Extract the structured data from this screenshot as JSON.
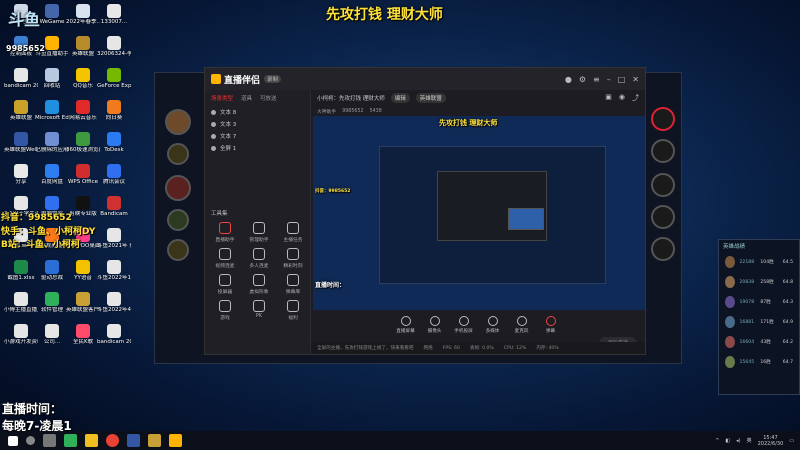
{
  "overlay": {
    "douyu_logo": "斗鱼",
    "room_id": "9985652",
    "title": "先攻打钱 理财大师",
    "douyin": "抖音：9985652",
    "kuaishou": "快手：斗鱼、小柯柯DY",
    "bilibili": "B站：斗鱼、小柯柯",
    "live_time_label": "直播时间：",
    "live_time_value": "每晚7-凌晨1"
  },
  "desktop_icons": [
    {
      "label": "我的电脑",
      "color": "#cfd8e6"
    },
    {
      "label": "WeGame",
      "color": "#4466aa"
    },
    {
      "label": "2022年春季...",
      "color": "#d9e2ef"
    },
    {
      "label": "133007...",
      "color": "#e8e8e8"
    },
    {
      "label": "控制面板",
      "color": "#3b7fd1"
    },
    {
      "label": "斗鱼直播助手",
      "color": "#ffb400"
    },
    {
      "label": "英雄联盟",
      "color": "#b88b2a"
    },
    {
      "label": "32006324-李鸿...",
      "color": "#e6e6e6"
    },
    {
      "label": "bandicam 2022-06-2...",
      "color": "#e6e6e6"
    },
    {
      "label": "回收站",
      "color": "#b6c9de"
    },
    {
      "label": "QQ音乐",
      "color": "#f5c400"
    },
    {
      "label": "GeForce Experience",
      "color": "#76b900"
    },
    {
      "label": "英雄联盟",
      "color": "#c9a227"
    },
    {
      "label": "Microsoft Edge",
      "color": "#1f8fe0"
    },
    {
      "label": "网易云音乐",
      "color": "#e02a2a"
    },
    {
      "label": "向日葵",
      "color": "#f07b1f"
    },
    {
      "label": "英雄联盟WeGame版",
      "color": "#3357a5"
    },
    {
      "label": "已删除的应用",
      "color": "#6f8fd0"
    },
    {
      "label": "360极速浏览器",
      "color": "#3d9a3d"
    },
    {
      "label": "ToDesk",
      "color": "#2a7af0"
    },
    {
      "label": "分享",
      "color": "#e9e9e9"
    },
    {
      "label": "百度网盘",
      "color": "#2c7df0"
    },
    {
      "label": "WPS Office",
      "color": "#d02e2e"
    },
    {
      "label": "腾讯会议",
      "color": "#2f6ff0"
    },
    {
      "label": "3.1用于学生课程设计...",
      "color": "#e6e6e6"
    },
    {
      "label": "电脑管家",
      "color": "#2f6ff0"
    },
    {
      "label": "剪映专业版",
      "color": "#111111"
    },
    {
      "label": "Bandicam",
      "color": "#d03030"
    },
    {
      "label": "米粒.wav",
      "color": "#eaeaea"
    },
    {
      "label": "腾讯视频播放器",
      "color": "#ff7a1a"
    },
    {
      "label": "UPUPOO桌面",
      "color": "#ff3e8a"
    },
    {
      "label": "斗鱼2021年下半年...",
      "color": "#e6e6e6"
    },
    {
      "label": "截图1.xlsx",
      "color": "#1d8a4a"
    },
    {
      "label": "驱动总裁",
      "color": "#2a6fd6"
    },
    {
      "label": "YY语音",
      "color": "#f2c200"
    },
    {
      "label": "斗鱼2022年1-3月直播...",
      "color": "#e6e6e6"
    },
    {
      "label": "小傅主播直播正式版",
      "color": "#e6e6e6"
    },
    {
      "label": "软件管理",
      "color": "#2fb15a"
    },
    {
      "label": "英雄联盟客户端",
      "color": "#c8a035"
    },
    {
      "label": "斗鱼2022年4-6月直播...",
      "color": "#e6e6e6"
    },
    {
      "label": "小游戏开发资料",
      "color": "#e6e6e6"
    },
    {
      "label": "公司...",
      "color": "#e6e6e6"
    },
    {
      "label": "全民K歌",
      "color": "#ff4a6a"
    },
    {
      "label": "bandicam 2022-06-2...",
      "color": "#e6e6e6"
    }
  ],
  "app": {
    "name": "直播伴侣",
    "version": "录制",
    "tabs": [
      "场景类型",
      "道具",
      "可放送"
    ],
    "sources": [
      "文本 8",
      "文本 3",
      "文本 7",
      "全屏 1"
    ],
    "tools_title": "工具集",
    "tools": [
      "直播助手",
      "管理助手",
      "主播任务",
      "视频连麦",
      "多人连麦",
      "精彩时刻",
      "投屏器",
      "虚拟形象",
      "弹幕库",
      "游戏",
      "PK",
      "福利"
    ],
    "room_title": "小柯柯：先攻打钱 理财大师",
    "room_tag": "编辑",
    "room_category": "英雄联盟",
    "room_streamer": "大神助手",
    "fans": "9985652",
    "viewers": "5438",
    "controls": [
      "直播屏幕",
      "摄像头",
      "手机投屏",
      "多媒体",
      "麦克风",
      "弹幕"
    ],
    "go_live": "开始直播",
    "status_items": [
      "全屏的主播，先攻打钱游戏上线了，快来看看吧",
      "网络",
      "FPS: 60",
      "丢帧: 0.0%",
      "CPU: 12%",
      "内存: 40%"
    ]
  },
  "right_panel": {
    "title": "英雄战绩",
    "rows": [
      {
        "a": "22188",
        "b": "104胜",
        "c": "64.5"
      },
      {
        "a": "20838",
        "b": "258胜",
        "c": "64.8"
      },
      {
        "a": "19078",
        "b": "87胜",
        "c": "64.3"
      },
      {
        "a": "16881",
        "b": "171胜",
        "c": "64.9"
      },
      {
        "a": "16604",
        "b": "43胜",
        "c": "64.2"
      },
      {
        "a": "15645",
        "b": "16胜",
        "c": "64.7"
      }
    ]
  },
  "taskbar": {
    "time": "15:47",
    "date": "2022/6/30",
    "ime": "英"
  }
}
